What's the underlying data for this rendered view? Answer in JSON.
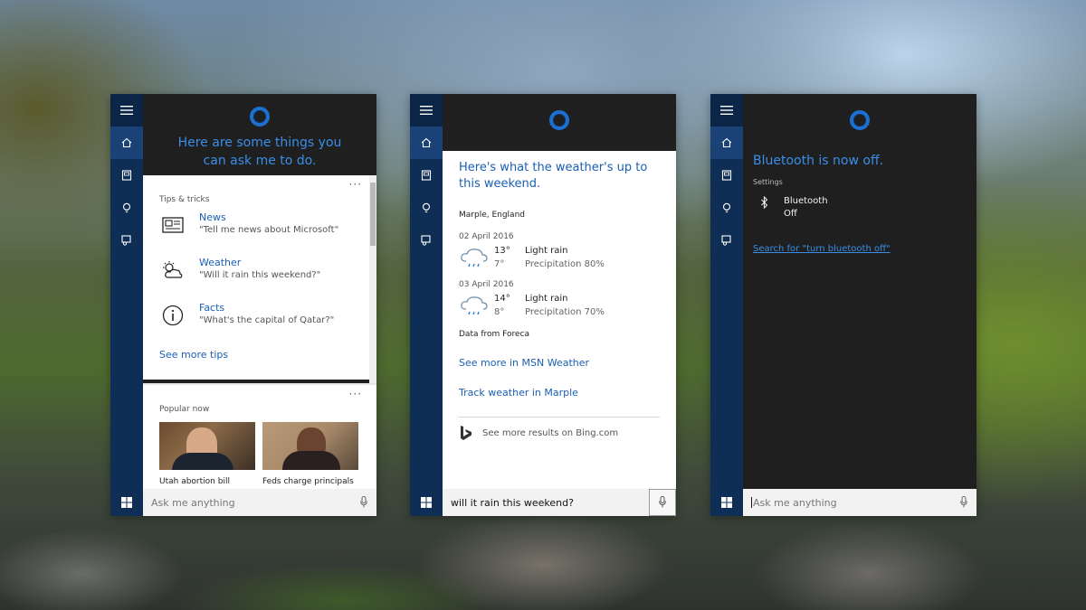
{
  "common": {
    "ask_placeholder": "Ask me anything"
  },
  "panel_home": {
    "greeting": "Here are some things you can ask me to do.",
    "tips_label": "Tips & tricks",
    "more_dots": "···",
    "tips": [
      {
        "title": "News",
        "example": "\"Tell me news about Microsoft\"",
        "icon": "newspaper-icon"
      },
      {
        "title": "Weather",
        "example": "\"Will it rain this weekend?\"",
        "icon": "partly-cloudy-icon"
      },
      {
        "title": "Facts",
        "example": "\"What's the capital of Qatar?\"",
        "icon": "info-icon"
      }
    ],
    "see_more_tips": "See more tips",
    "popular_label": "Popular now",
    "news": [
      {
        "caption": "Utah abortion bill"
      },
      {
        "caption": "Feds charge principals"
      }
    ]
  },
  "panel_weather": {
    "title": "Here's what the weather's up to this weekend.",
    "location": "Marple, England",
    "days": [
      {
        "date": "02 April 2016",
        "high": "13°",
        "low": "7°",
        "condition": "Light rain",
        "precip": "Precipitation 80%"
      },
      {
        "date": "03 April 2016",
        "high": "14°",
        "low": "8°",
        "condition": "Light rain",
        "precip": "Precipitation 70%"
      }
    ],
    "source": "Data from Foreca",
    "link_msn": "See more in MSN Weather",
    "link_track": "Track weather in Marple",
    "bing_text": "See more results on Bing.com",
    "query": "will it rain this weekend?"
  },
  "panel_bluetooth": {
    "title": "Bluetooth is now off.",
    "settings_label": "Settings",
    "setting_name": "Bluetooth",
    "setting_state": "Off",
    "search_link": "Search for \"turn bluetooth off\""
  },
  "colors": {
    "rail": "#0f2e55",
    "accent_blue": "#1a5fb4",
    "cortana_ring": "#1d6fd0",
    "dark_bg": "#1f1f1f"
  }
}
